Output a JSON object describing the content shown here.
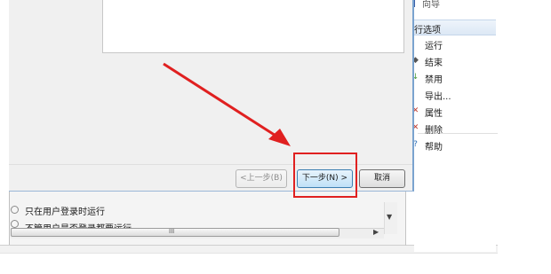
{
  "dialog": {
    "buttons": {
      "back_label": "<上一步(B)",
      "next_label": "下一步(N) >",
      "cancel_label": "取消"
    }
  },
  "actions_pane": {
    "top_item": "向导",
    "header": "行选项",
    "items": [
      {
        "label": "运行",
        "icon": "run-icon"
      },
      {
        "label": "结束",
        "icon": "end-icon"
      },
      {
        "label": "禁用",
        "icon": "disable-icon"
      },
      {
        "label": "导出...",
        "icon": "export-icon"
      },
      {
        "label": "属性",
        "icon": "properties-icon"
      },
      {
        "label": "删除",
        "icon": "delete-icon"
      },
      {
        "label": "帮助",
        "icon": "help-icon"
      }
    ]
  },
  "security_options": {
    "option1": "只在用户登录时运行",
    "option2": "不管用户是否登录都要运行"
  },
  "colors": {
    "highlight": "#e02020",
    "arrow": "#e02020",
    "delete_icon": "#c0392b"
  }
}
